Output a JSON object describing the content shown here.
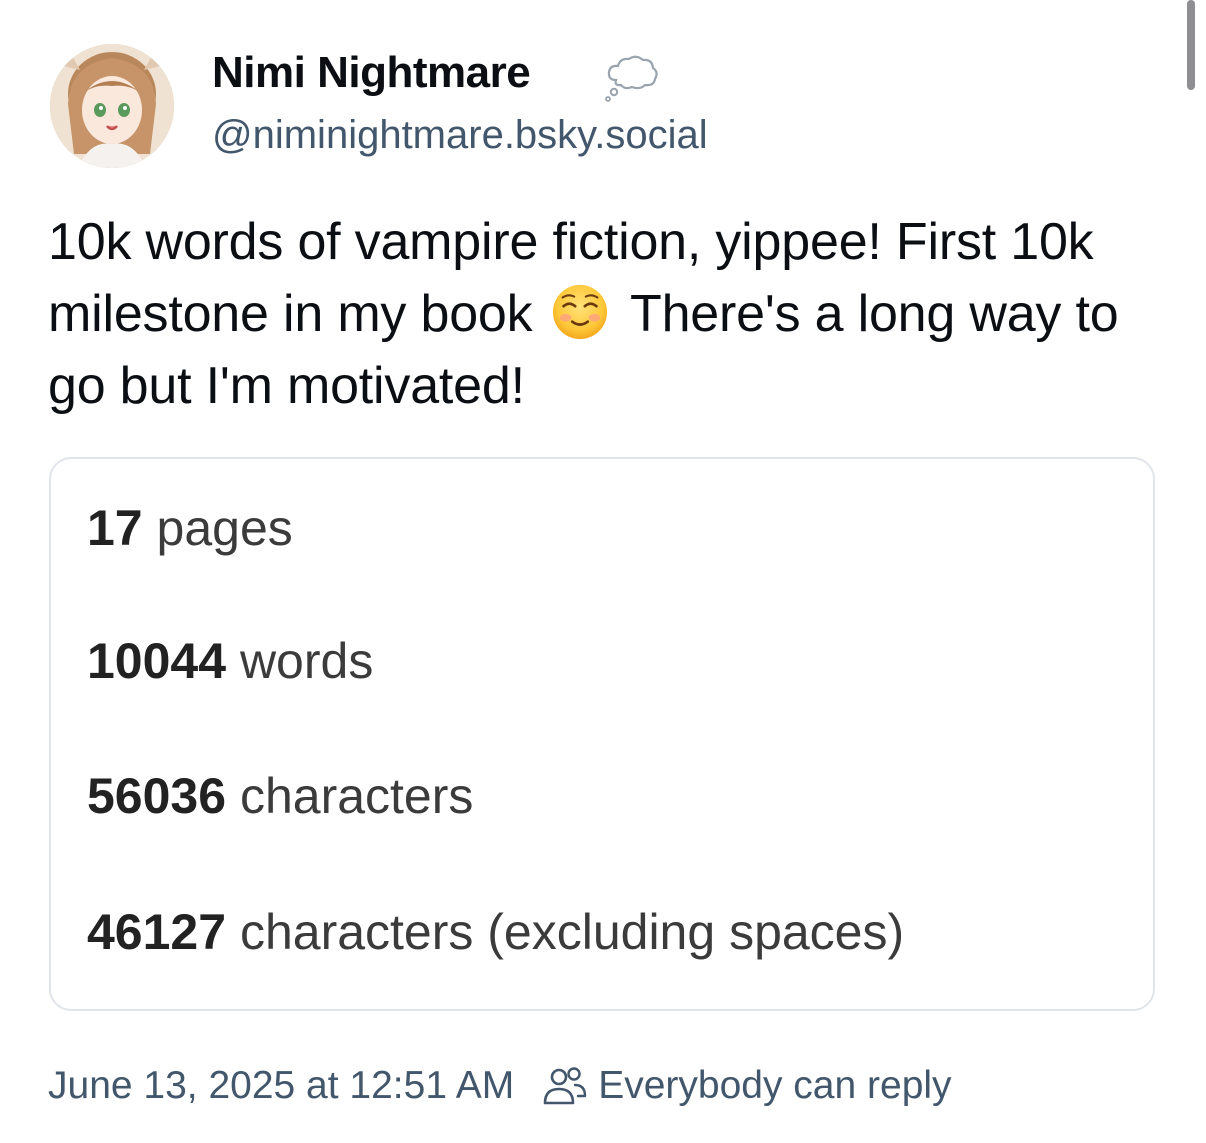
{
  "author": {
    "display_name": "Nimi Nightmare",
    "handle": "@niminightmare.bsky.social",
    "avatar_icon": "avatar-image",
    "badge_icon": "thought-bubble-icon"
  },
  "post": {
    "text_part1": "10k words of vampire fiction, yippee! First 10k milestone in my book",
    "emoji": "smiling-face-emoji",
    "text_part2": "There's a long way to go but I'm motivated!"
  },
  "stats_card": {
    "rows": [
      {
        "number": "17",
        "label": "pages"
      },
      {
        "number": "10044",
        "label": "words"
      },
      {
        "number": "56036",
        "label": "characters"
      },
      {
        "number": "46127",
        "label": "characters (excluding spaces)"
      }
    ]
  },
  "footer": {
    "timestamp": "June 13, 2025 at 12:51 AM",
    "reply_icon": "people-icon",
    "reply_setting": "Everybody can reply"
  },
  "colors": {
    "text_primary": "#0b0f14",
    "text_secondary": "#42576c",
    "card_border": "#e1e5ea"
  }
}
